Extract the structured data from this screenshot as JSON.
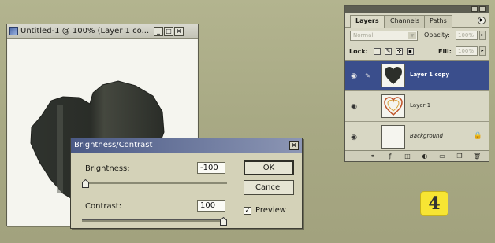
{
  "document_window": {
    "title": "Untitled-1 @ 100% (Layer 1 co...",
    "controls": {
      "minimize": "_",
      "maximize": "□",
      "close": "×"
    },
    "app_icon": "photoshop-document-icon"
  },
  "layers_panel": {
    "tabs": [
      {
        "label": "Layers",
        "active": true
      },
      {
        "label": "Channels",
        "active": false
      },
      {
        "label": "Paths",
        "active": false
      }
    ],
    "menu_icon": "panel-menu-icon",
    "blend_mode": "Normal",
    "opacity_label": "Opacity:",
    "opacity_value": "100%",
    "lock_label": "Lock:",
    "fill_label": "Fill:",
    "fill_value": "100%",
    "layers": [
      {
        "name": "Layer 1 copy",
        "selected": true,
        "visible": true,
        "italic": false,
        "thumb": "black-heart"
      },
      {
        "name": "Layer 1",
        "selected": false,
        "visible": true,
        "italic": false,
        "thumb": "outlined-heart"
      },
      {
        "name": "Background",
        "selected": false,
        "visible": true,
        "italic": true,
        "thumb": "white",
        "locked": true
      }
    ],
    "bottom_icons": [
      "link-layers-icon",
      "layer-style-icon",
      "layer-mask-icon",
      "adjustment-layer-icon",
      "new-group-icon",
      "new-layer-icon",
      "trash-icon"
    ]
  },
  "bc_dialog": {
    "title": "Brightness/Contrast",
    "close": "×",
    "brightness_label": "Brightness:",
    "brightness_value": "-100",
    "contrast_label": "Contrast:",
    "contrast_value": "100",
    "ok_label": "OK",
    "cancel_label": "Cancel",
    "preview_label": "Preview",
    "preview_checked": true,
    "brightness_slider_fraction": 0.0,
    "contrast_slider_fraction": 1.0
  },
  "step_badge": "4",
  "colors": {
    "selection": "#3a4e8c",
    "heart": "#2c2f2a",
    "badge": "#f7e533"
  }
}
